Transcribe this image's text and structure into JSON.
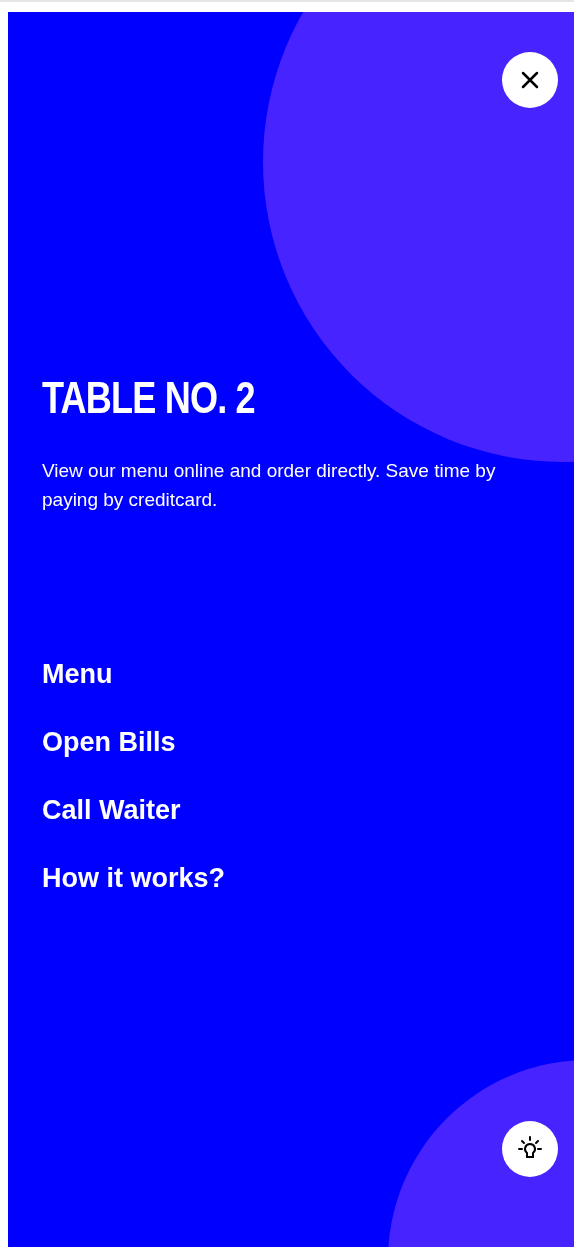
{
  "title": "TABLE NO. 2",
  "description": "View our menu online and order directly. Save time by paying by creditcard.",
  "menu_items": [
    "Menu",
    "Open Bills",
    "Call Waiter",
    "How it works?"
  ]
}
